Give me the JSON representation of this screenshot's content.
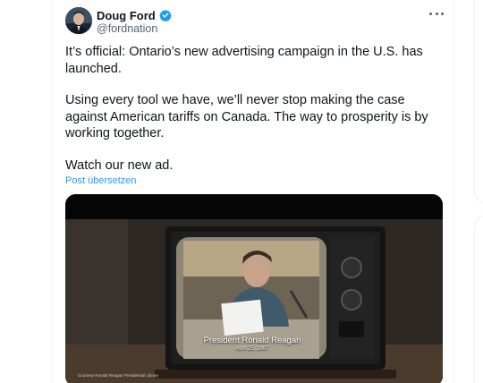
{
  "author": {
    "display_name": "Doug Ford",
    "handle": "@fordnation",
    "verified": true,
    "verified_color": "#1d9bf0"
  },
  "tweet": {
    "paragraph_1": "It’s official: Ontario’s new advertising campaign in the U.S. has launched.",
    "paragraph_2": "Using every tool we have, we’ll never stop making the case against American tariffs on Canada. The way to prosperity is by working together.",
    "paragraph_3": "Watch our new ad.",
    "translate_label": "Post übersetzen"
  },
  "media": {
    "caption_name": "President Ronald Reagan",
    "caption_date": "April 25, 1987",
    "courtesy": "Courtesy Ronald Reagan Presidential Library"
  },
  "icons": {
    "more": "more-horizontal-icon",
    "verified": "verified-badge-icon"
  },
  "colors": {
    "link": "#1d9bf0",
    "secondary_text": "#536471",
    "primary_text": "#0f1419"
  }
}
